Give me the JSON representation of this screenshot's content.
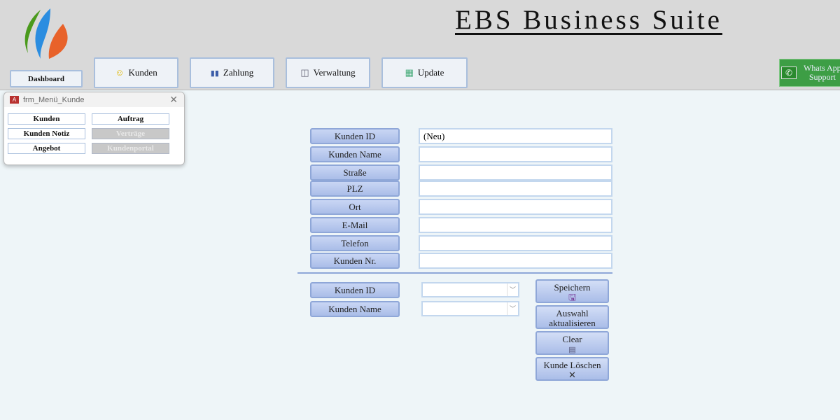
{
  "header": {
    "title": "EBS Business Suite"
  },
  "nav": {
    "dashboard": "Dashboard",
    "kunden": "Kunden",
    "zahlung": "Zahlung",
    "verwaltung": "Verwaltung",
    "update": "Update"
  },
  "whatsapp": {
    "line1": "Whats App",
    "line2": "Support"
  },
  "popup": {
    "title": "frm_Menü_Kunde",
    "buttons": [
      "Kunden",
      "Auftrag",
      "Kunden Notiz",
      "Verträge",
      "Angebot",
      "Kundenportal"
    ]
  },
  "form": {
    "labels": [
      "Kunden ID",
      "Kunden Name",
      "Straße",
      "PLZ",
      "Ort",
      "E-Mail",
      "Telefon",
      "Kunden Nr."
    ],
    "values": [
      "(Neu)",
      "",
      "",
      "",
      "",
      "",
      "",
      ""
    ]
  },
  "search": {
    "labels": [
      "Kunden ID",
      "Kunden Name"
    ]
  },
  "actions": {
    "save": "Speichern",
    "refresh1": "Auswahl",
    "refresh2": "aktualisieren",
    "clear": "Clear",
    "delete": "Kunde Löschen"
  }
}
